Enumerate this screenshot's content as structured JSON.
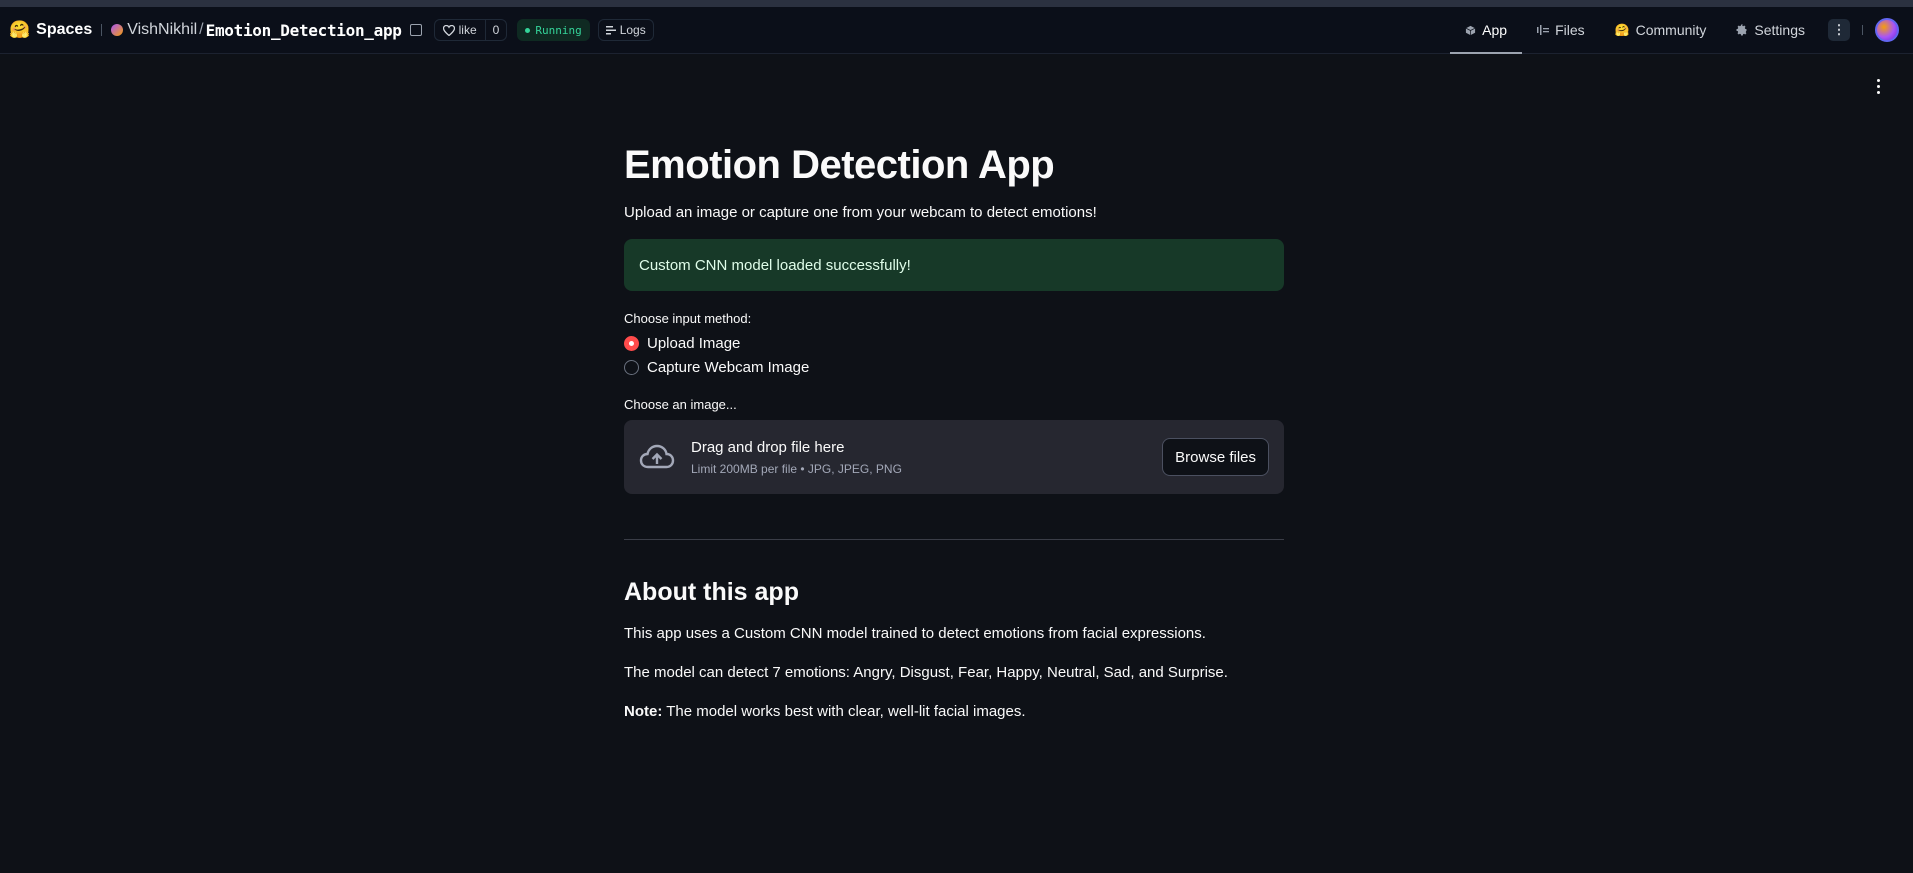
{
  "header": {
    "spaces_label": "Spaces",
    "owner": "VishNikhil",
    "separator": "/",
    "repo": "Emotion_Detection_app",
    "like_label": "like",
    "like_count": "0",
    "status": "Running",
    "logs_label": "Logs",
    "tabs": [
      {
        "label": "App",
        "icon": "cube-icon",
        "active": true
      },
      {
        "label": "Files",
        "icon": "files-icon",
        "active": false
      },
      {
        "label": "Community",
        "icon": "community-icon",
        "active": false
      },
      {
        "label": "Settings",
        "icon": "gear-icon",
        "active": false
      }
    ]
  },
  "app": {
    "title": "Emotion Detection App",
    "subtitle": "Upload an image or capture one from your webcam to detect emotions!",
    "success_message": "Custom CNN model loaded successfully!",
    "input_method_label": "Choose input method:",
    "options": [
      "Upload Image",
      "Capture Webcam Image"
    ],
    "selected_option": "Upload Image",
    "uploader_label": "Choose an image...",
    "uploader_title": "Drag and drop file here",
    "uploader_limits": "Limit 200MB per file • JPG, JPEG, PNG",
    "browse_label": "Browse files",
    "about_title": "About this app",
    "about_p1": "This app uses a Custom CNN model trained to detect emotions from facial expressions.",
    "about_p2": "The model can detect 7 emotions: Angry, Disgust, Fear, Happy, Neutral, Sad, and Surprise.",
    "about_note_label": "Note:",
    "about_note_text": " The model works best with clear, well-lit facial images."
  },
  "colors": {
    "background": "#0e1117",
    "accent": "#ff4b4b",
    "success_bg": "#173928",
    "running": "#34d399"
  }
}
